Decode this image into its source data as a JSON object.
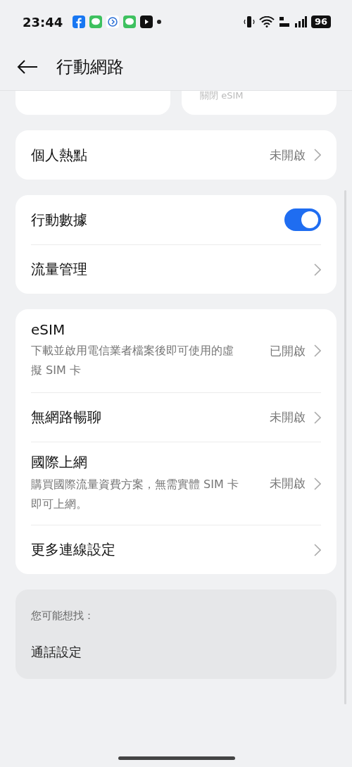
{
  "status_bar": {
    "time": "23:44",
    "battery": "96"
  },
  "header": {
    "title": "行動網路"
  },
  "top_cards": [
    {
      "kind": "blank"
    },
    {
      "kind": "caption",
      "caption": "關閉 eSIM"
    }
  ],
  "groups": [
    {
      "items": [
        {
          "kind": "link",
          "title": "個人熱點",
          "value": "未開啟"
        }
      ]
    },
    {
      "items": [
        {
          "kind": "switch",
          "title": "行動數據",
          "on": true
        },
        {
          "kind": "link",
          "title": "流量管理"
        }
      ]
    },
    {
      "items": [
        {
          "kind": "link",
          "title": "eSIM",
          "description": "下載並啟用電信業者檔案後即可使用的虛擬 SIM 卡",
          "value": "已開啟"
        },
        {
          "kind": "link",
          "title": "無網路暢聊",
          "value": "未開啟"
        },
        {
          "kind": "link",
          "title": "國際上網",
          "description": "購買國際流量資費方案，無需實體 SIM 卡即可上網。",
          "value": "未開啟"
        },
        {
          "kind": "link",
          "title": "更多連線設定"
        }
      ]
    }
  ],
  "suggestions": {
    "heading": "您可能想找：",
    "items": [
      "通話設定"
    ]
  }
}
